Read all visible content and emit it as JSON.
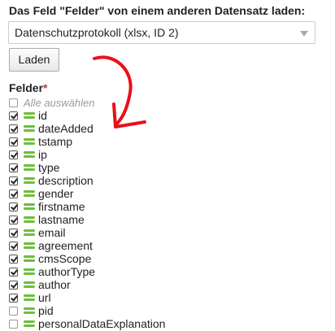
{
  "heading": "Das Feld \"Felder\" von einem anderen Datensatz laden:",
  "source_select": {
    "selected": "Datenschutzprotokoll (xlsx, ID 2)"
  },
  "load_button": "Laden",
  "fields_label": "Felder",
  "required_mark": "*",
  "select_all": {
    "label": "Alle auswählen",
    "checked": false
  },
  "fields": [
    {
      "name": "id",
      "checked": true
    },
    {
      "name": "dateAdded",
      "checked": true
    },
    {
      "name": "tstamp",
      "checked": true
    },
    {
      "name": "ip",
      "checked": true
    },
    {
      "name": "type",
      "checked": true
    },
    {
      "name": "description",
      "checked": true
    },
    {
      "name": "gender",
      "checked": true
    },
    {
      "name": "firstname",
      "checked": true
    },
    {
      "name": "lastname",
      "checked": true
    },
    {
      "name": "email",
      "checked": true
    },
    {
      "name": "agreement",
      "checked": true
    },
    {
      "name": "cmsScope",
      "checked": true
    },
    {
      "name": "authorType",
      "checked": true
    },
    {
      "name": "author",
      "checked": true
    },
    {
      "name": "url",
      "checked": true
    },
    {
      "name": "pid",
      "checked": false
    },
    {
      "name": "personalDataExplanation",
      "checked": false
    }
  ],
  "colors": {
    "handle": "#6bbf3a",
    "required": "#cc3333",
    "annotation_arrow": "#e8101a"
  },
  "icons": {
    "drag_handle": "drag-handle-icon",
    "dropdown": "chevron-down-icon"
  }
}
